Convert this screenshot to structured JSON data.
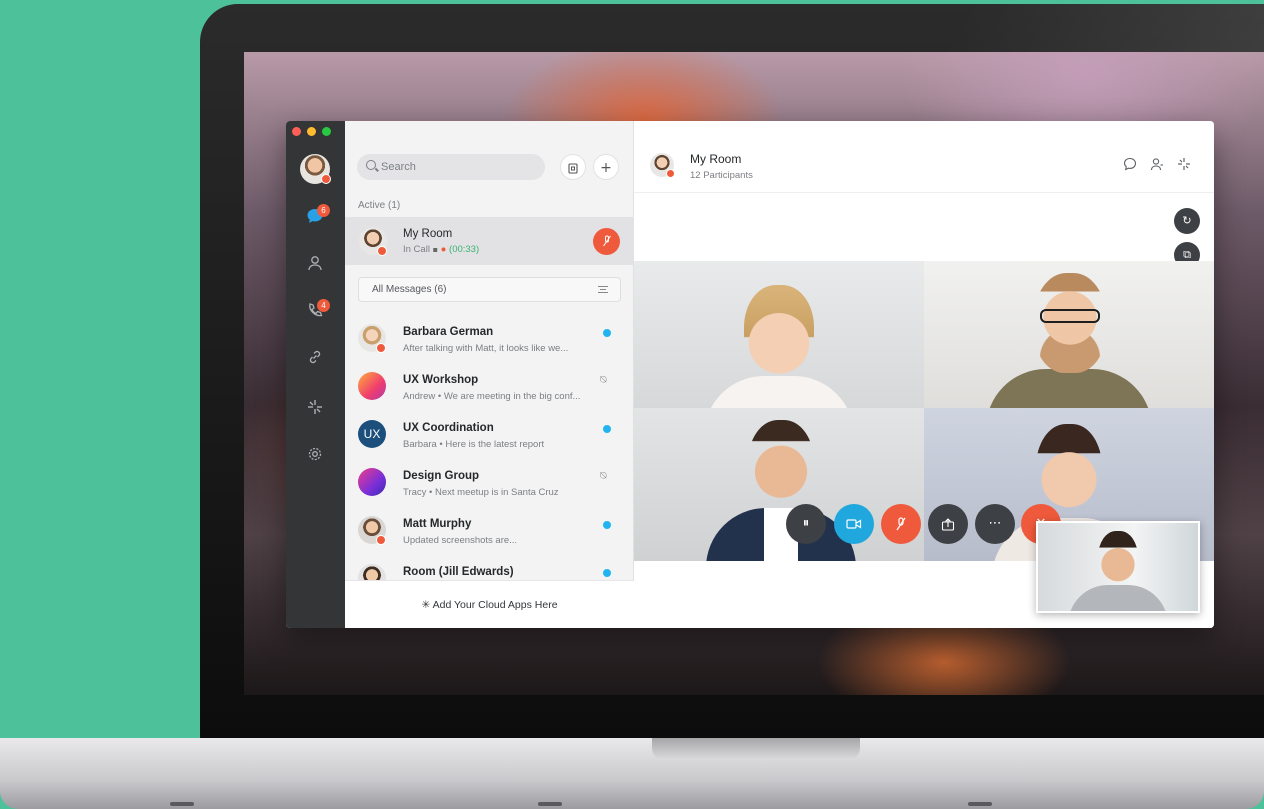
{
  "sidebar_rail": {
    "unread_messages": "6",
    "missed_calls": "4"
  },
  "list": {
    "search_placeholder": "Search",
    "active_label": "Active (1)",
    "active_room": {
      "title": "My Room",
      "status": "In Call",
      "timer": "(00:33)"
    },
    "filter_label": "All Messages (6)",
    "messages": [
      {
        "title": "Barbara German",
        "preview": "After talking with Matt, it looks like we...",
        "indicator": "unread"
      },
      {
        "title": "UX Workshop",
        "preview": "Andrew • We are meeting in the big conf...",
        "indicator": "muted"
      },
      {
        "title": "UX Coordination",
        "preview": "Barbara • Here is the latest report",
        "indicator": "unread",
        "avatar_text": "UX"
      },
      {
        "title": "Design Group",
        "preview": "Tracy • Next meetup is in Santa Cruz",
        "indicator": "muted"
      },
      {
        "title": "Matt Murphy",
        "preview": "Updated screenshots are...",
        "indicator": "unread"
      },
      {
        "title": "Room (Jill Edwards)",
        "preview": "",
        "indicator": "unread"
      }
    ],
    "footer_label": "Add Your Cloud Apps Here"
  },
  "main": {
    "room_title": "My Room",
    "participants": "12 Participants"
  },
  "colors": {
    "accent_blue": "#22b4ee",
    "alert_red": "#ef5a3c",
    "rail_bg": "#333537",
    "in_call_green": "#3bb273"
  }
}
